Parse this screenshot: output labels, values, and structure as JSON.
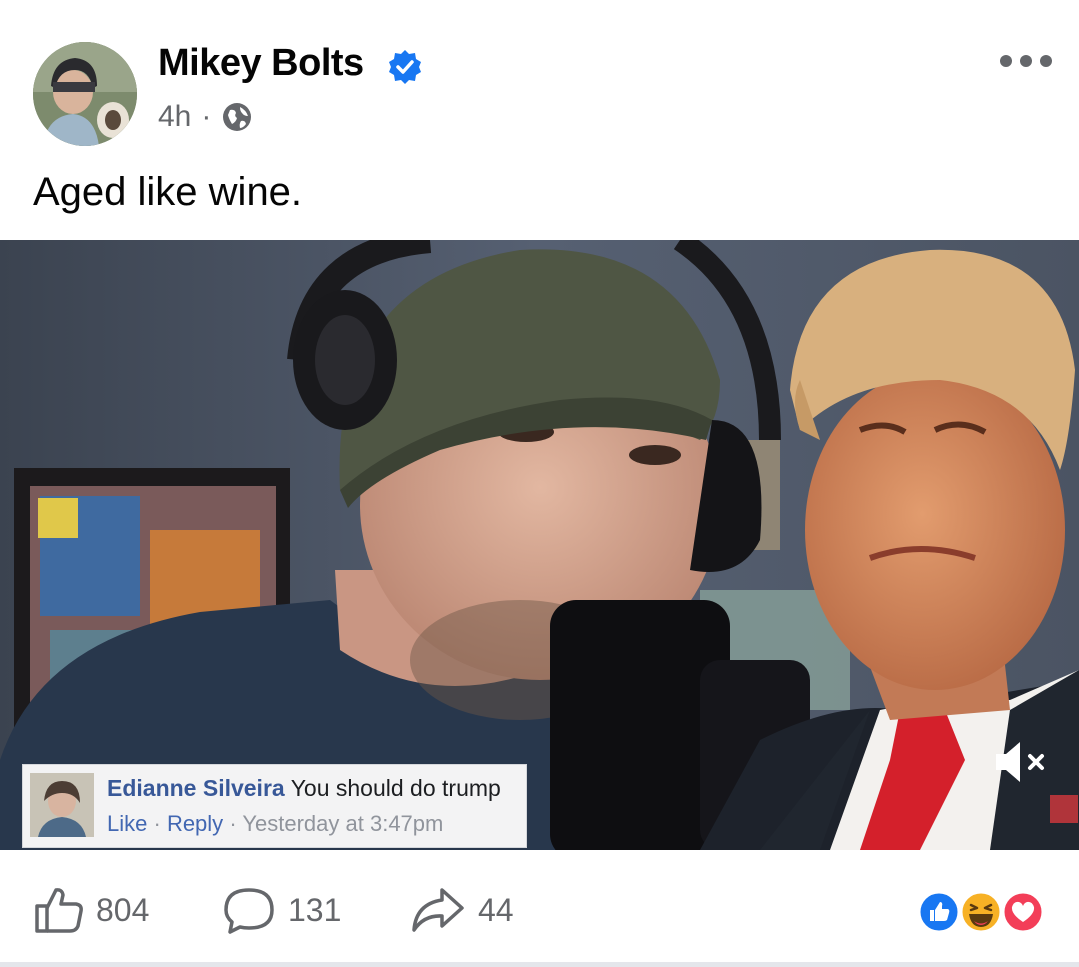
{
  "post": {
    "author": "Mikey Bolts",
    "timestamp": "4h",
    "separator": "·",
    "privacy_icon": "globe-icon",
    "text": "Aged like wine."
  },
  "media": {
    "comment": {
      "name": "Edianne Silveira",
      "text": "You should do trump",
      "like": "Like",
      "dot1": "·",
      "reply": "Reply",
      "dot2": "·",
      "time": "Yesterday at 3:47pm"
    },
    "mute_icon": "speaker-muted-icon"
  },
  "actions": {
    "likes": "804",
    "comments": "131",
    "shares": "44"
  },
  "colors": {
    "verified": "#1877f2",
    "like_reaction": "#1877f2",
    "haha_reaction": "#f7b125",
    "love_reaction": "#f33e58",
    "comment_name": "#385898"
  }
}
